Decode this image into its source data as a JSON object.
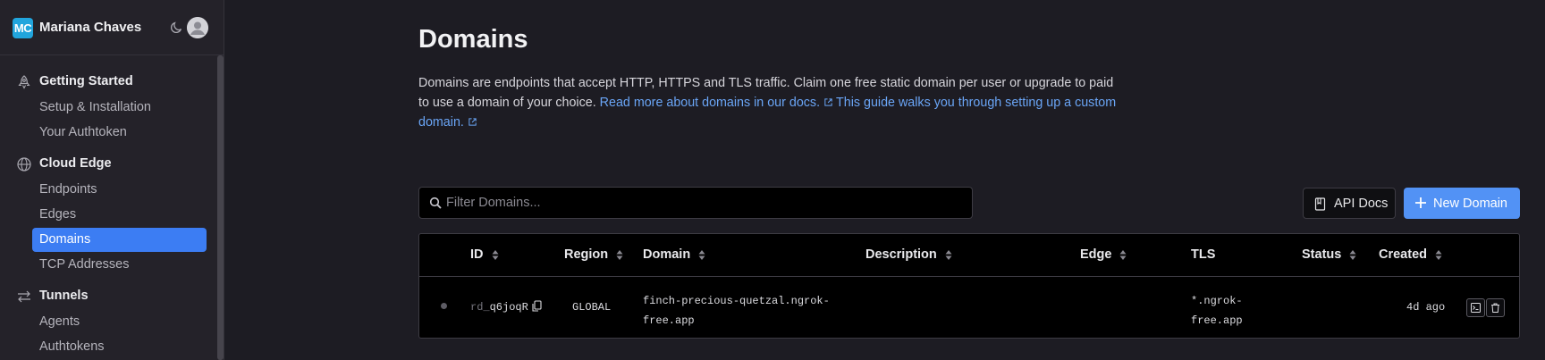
{
  "user": {
    "initials": "MC",
    "name": "Mariana Chaves"
  },
  "sidebar": {
    "sections": [
      {
        "title": "Getting Started",
        "icon": "rocket-icon",
        "items": [
          "Setup & Installation",
          "Your Authtoken"
        ]
      },
      {
        "title": "Cloud Edge",
        "icon": "globe-icon",
        "items": [
          "Endpoints",
          "Edges",
          "Domains",
          "TCP Addresses"
        ]
      },
      {
        "title": "Tunnels",
        "icon": "arrows-left-right-icon",
        "items": [
          "Agents",
          "Authtokens"
        ]
      }
    ],
    "active_item": "Domains"
  },
  "page": {
    "title": "Domains",
    "description": "Domains are endpoints that accept HTTP, HTTPS and TLS traffic. Claim one free static domain per user or upgrade to paid to use a domain of your choice.",
    "link_docs": "Read more about domains in our docs.",
    "link_guide": "This guide walks you through setting up a custom domain."
  },
  "toolbar": {
    "filter_placeholder": "Filter Domains...",
    "api_docs_label": "API Docs",
    "new_domain_label": "New Domain"
  },
  "table": {
    "columns": [
      "ID",
      "Region",
      "Domain",
      "Description",
      "Edge",
      "TLS",
      "Status",
      "Created"
    ],
    "rows": [
      {
        "id_prefix": "rd_",
        "id_suffix": "q6joqR",
        "region": "GLOBAL",
        "domain_line1": "finch-precious-quetzal.ngrok-",
        "domain_line2": "free.app",
        "description": "",
        "edge": "",
        "tls_line1": "*.ngrok-",
        "tls_line2": "free.app",
        "status": "",
        "created": "4d ago"
      }
    ]
  },
  "colors": {
    "accent": "#3c7df3",
    "button_primary": "#5292f5",
    "link": "#6aa5f6",
    "background": "#1d1c23"
  }
}
